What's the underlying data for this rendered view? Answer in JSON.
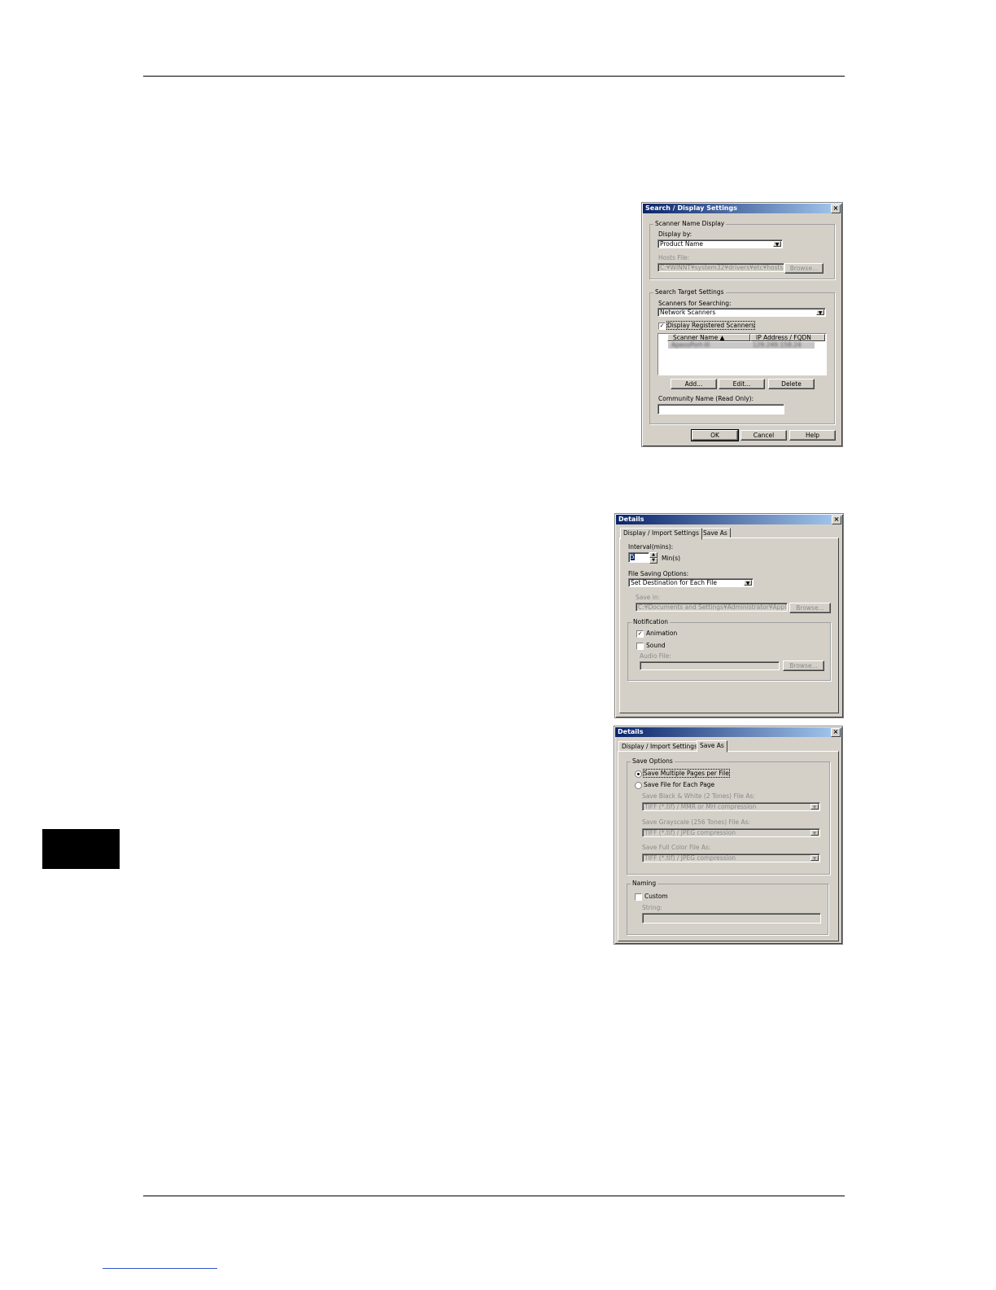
{
  "search_dialog": {
    "title": "Search / Display Settings",
    "scanner_name_group": "Scanner Name Display",
    "display_by_label": "Display by:",
    "display_by_value": "Product Name",
    "hosts_file_label": "Hosts File:",
    "hosts_file_value": "C:¥WINNT¥system32¥drivers¥etc¥hosts",
    "browse_label": "Browse...",
    "search_target_group": "Search Target Settings",
    "scanners_for_searching_label": "Scanners for Searching:",
    "scanners_for_searching_value": "Network Scanners",
    "display_registered_label": "Display Registered Scanners",
    "col_scanner_name": "Scanner Name",
    "col_ip_address": "IP Address / FQDN",
    "row_scanner_name": "ApeosPort-III",
    "row_ip_address": "129.249.158.24",
    "add_label": "Add...",
    "edit_label": "Edit...",
    "delete_label": "Delete",
    "community_name_label": "Community Name (Read Only):",
    "ok_label": "OK",
    "cancel_label": "Cancel",
    "help_label": "Help"
  },
  "details_dialog_1": {
    "title": "Details",
    "tab_display_import": "Display / Import Settings",
    "tab_save_as": "Save As",
    "interval_label": "Interval(mins):",
    "interval_value": "5",
    "interval_unit": "Min(s)",
    "file_saving_label": "File Saving Options:",
    "file_saving_value": "Set Destination for Each File",
    "save_in_label": "Save in:",
    "save_in_value": "C:¥Documents and Settings¥Administrator¥Applicatio",
    "browse_label": "Browse...",
    "notification_group": "Notification",
    "animation_label": "Animation",
    "sound_label": "Sound",
    "audio_file_label": "Audio File:",
    "browse2_label": "Browse..."
  },
  "details_dialog_2": {
    "title": "Details",
    "tab_display_import": "Display / Import Settings",
    "tab_save_as": "Save As",
    "save_options_group": "Save Options",
    "save_multiple_label": "Save Multiple Pages per File",
    "save_each_label": "Save File for Each Page",
    "bw_label": "Save Black & White (2 Tones) File As:",
    "bw_value": "TIFF (*.tif) / MMR or MH compression",
    "gray_label": "Save Grayscale (256 Tones) File As:",
    "gray_value": "TIFF (*.tif) / JPEG compression",
    "color_label": "Save Full Color File As:",
    "color_value": "TIFF (*.tif) / JPEG compression",
    "naming_group": "Naming",
    "custom_label": "Custom",
    "string_label": "String:"
  }
}
